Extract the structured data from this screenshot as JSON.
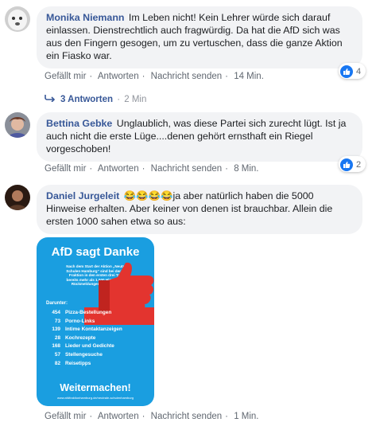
{
  "colors": {
    "link": "#385898",
    "bubble": "#f2f3f5",
    "meta": "#606770",
    "like": "#1877f2",
    "flyer_bg": "#1a9ee0"
  },
  "comments": [
    {
      "author": "Monika Niemann",
      "text": "Im Leben nicht! Kein Lehrer würde sich darauf einlassen. Dienstrechtlich auch fragwürdig. Da hat die AfD sich was aus den Fingern gesogen, um zu vertuschen, dass die ganze Aktion ein Fiasko war.",
      "like": "Gefällt mir",
      "reply": "Antworten",
      "message": "Nachricht senden",
      "time": "14 Min.",
      "reactions": "4"
    },
    {
      "author": "Bettina Gebke",
      "text": "Unglaublich, was diese Partei sich zurecht lügt. Ist ja auch nicht die erste Lüge....denen gehört ernsthaft ein Riegel vorgeschoben!",
      "like": "Gefällt mir",
      "reply": "Antworten",
      "message": "Nachricht senden",
      "time": "8 Min.",
      "reactions": "2"
    },
    {
      "author": "Daniel Jurgeleit",
      "emoji": "😂😂😂😂",
      "text": "ja aber natürlich haben die 5000 Hinweise erhalten. Aber keiner von denen ist brauchbar. Allein die ersten 1000 sahen etwa so aus:",
      "like": "Gefällt mir",
      "reply": "Antworten",
      "message": "Nachricht senden",
      "time": "1 Min."
    }
  ],
  "replies": {
    "count": "3 Antworten",
    "time": "2 Min"
  },
  "flyer": {
    "title": "AfD sagt Danke",
    "intro": "Nach dem Start der Aktion „Neutrale Schulen Hamburg“ sind bei der AfD-Fraktion in den ersten drei Tagen bereits mehr als 1.000 Hinweise und Rückmeldungen eingegangen.",
    "subtitle": "Darunter:",
    "items": [
      {
        "n": "454",
        "label": "Pizza-Bestellungen"
      },
      {
        "n": "73",
        "label": "Porno-Links"
      },
      {
        "n": "139",
        "label": "Intime Kontaktanzeigen"
      },
      {
        "n": "28",
        "label": "Kochrezepte"
      },
      {
        "n": "168",
        "label": "Lieder und Gedichte"
      },
      {
        "n": "57",
        "label": "Stellengesuche"
      },
      {
        "n": "82",
        "label": "Reisetipps"
      }
    ],
    "cta": "Weitermachen!",
    "url": "www.afdfraktionhamburg.de/neutrale-schulenhamburg"
  }
}
